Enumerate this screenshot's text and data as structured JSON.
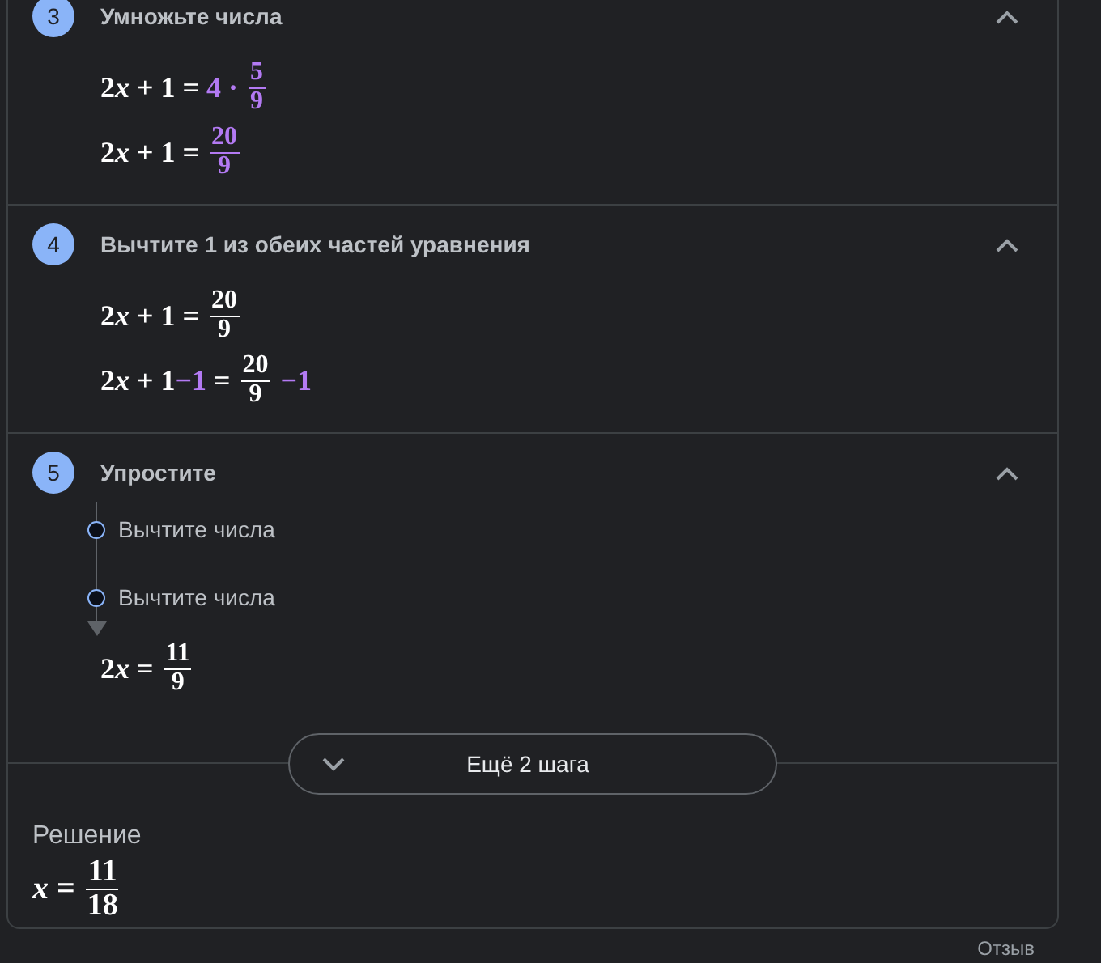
{
  "steps": [
    {
      "number": "3",
      "title": "Умножьте числа",
      "expanded": true,
      "lines": [
        [
          {
            "kind": "text",
            "text": "2",
            "highlight": false
          },
          {
            "kind": "var",
            "text": "x",
            "highlight": false
          },
          {
            "kind": "text",
            "text": " + 1 = ",
            "highlight": false
          },
          {
            "kind": "text",
            "text": "4 · ",
            "highlight": true
          },
          {
            "kind": "frac",
            "num": "5",
            "den": "9",
            "highlight": true
          }
        ],
        [
          {
            "kind": "text",
            "text": "2",
            "highlight": false
          },
          {
            "kind": "var",
            "text": "x",
            "highlight": false
          },
          {
            "kind": "text",
            "text": " + 1 = ",
            "highlight": false
          },
          {
            "kind": "frac",
            "num": "20",
            "den": "9",
            "highlight": true
          }
        ]
      ]
    },
    {
      "number": "4",
      "title": "Вычтите **1** из обеих частей уравнения",
      "expanded": true,
      "lines": [
        [
          {
            "kind": "text",
            "text": "2",
            "highlight": false
          },
          {
            "kind": "var",
            "text": "x",
            "highlight": false
          },
          {
            "kind": "text",
            "text": " + 1 = ",
            "highlight": false
          },
          {
            "kind": "frac",
            "num": "20",
            "den": "9",
            "highlight": false
          }
        ],
        [
          {
            "kind": "text",
            "text": "2",
            "highlight": false
          },
          {
            "kind": "var",
            "text": "x",
            "highlight": false
          },
          {
            "kind": "text",
            "text": " + 1",
            "highlight": false
          },
          {
            "kind": "text",
            "text": "−1",
            "highlight": true
          },
          {
            "kind": "text",
            "text": " = ",
            "highlight": false
          },
          {
            "kind": "frac",
            "num": "20",
            "den": "9",
            "highlight": false
          },
          {
            "kind": "text",
            "text": " −1",
            "highlight": true
          }
        ]
      ]
    },
    {
      "number": "5",
      "title": "Упростите",
      "expanded": true,
      "substeps": [
        {
          "label": "Вычтите числа"
        },
        {
          "label": "Вычтите числа"
        }
      ],
      "lines": [
        [
          {
            "kind": "text",
            "text": "2",
            "highlight": false
          },
          {
            "kind": "var",
            "text": "x",
            "highlight": false
          },
          {
            "kind": "text",
            "text": " = ",
            "highlight": false
          },
          {
            "kind": "frac",
            "num": "11",
            "den": "9",
            "highlight": false
          }
        ]
      ]
    }
  ],
  "more_button": {
    "label": "Ещё 2 шага"
  },
  "solution": {
    "heading": "Решение",
    "lines": [
      [
        {
          "kind": "var",
          "text": "x",
          "highlight": false
        },
        {
          "kind": "text",
          "text": " = ",
          "highlight": false
        },
        {
          "kind": "frac",
          "num": "11",
          "den": "18",
          "highlight": false
        }
      ]
    ]
  },
  "feedback_link": "Отзыв"
}
